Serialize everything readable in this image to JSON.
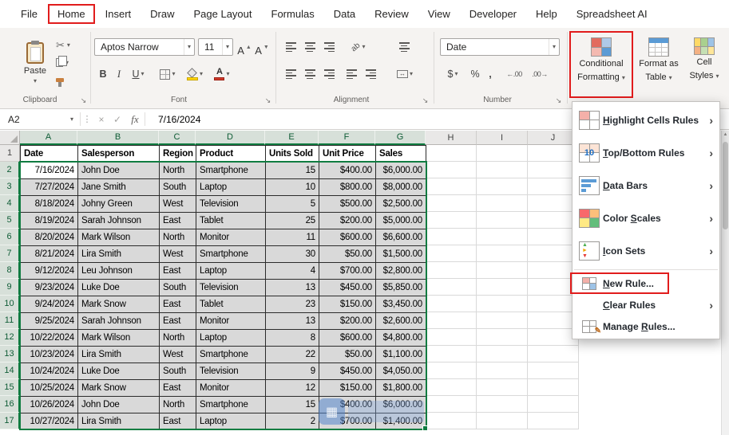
{
  "menu_bar": {
    "items": [
      "File",
      "Home",
      "Insert",
      "Draw",
      "Page Layout",
      "Formulas",
      "Data",
      "Review",
      "View",
      "Developer",
      "Help",
      "Spreadsheet AI"
    ],
    "active_item": "Home"
  },
  "ribbon": {
    "clipboard": {
      "paste": "Paste",
      "group": "Clipboard"
    },
    "font": {
      "name": "Aptos Narrow",
      "size": "11",
      "bold": "B",
      "italic": "I",
      "underline": "U",
      "grow": "A",
      "shrink": "A",
      "color_letter": "A",
      "group": "Font"
    },
    "alignment": {
      "orientation": "ab",
      "group": "Alignment"
    },
    "number": {
      "format": "Date",
      "currency": "$",
      "percent": "%",
      "comma": ",",
      "inc": "←.00",
      "dec": ".00→",
      "group": "Number"
    },
    "styles": {
      "cf1": "Conditional",
      "cf2": "Formatting",
      "fat1": "Format as",
      "fat2": "Table",
      "cs1": "Cell",
      "cs2": "Styles"
    }
  },
  "formula_bar": {
    "name_box": "A2",
    "fx_label": "fx",
    "value": "7/16/2024"
  },
  "sheet": {
    "column_headers": [
      "A",
      "B",
      "C",
      "D",
      "E",
      "F",
      "G",
      "H",
      "I",
      "J"
    ],
    "selected_columns": [
      "A",
      "B",
      "C",
      "D",
      "E",
      "F",
      "G"
    ],
    "row_count": 17,
    "active_cell": "A2",
    "selection": "A2:G17",
    "table": {
      "headers": [
        "Date",
        "Salesperson",
        "Region",
        "Product",
        "Units Sold",
        "Unit Price",
        "Sales"
      ],
      "rows": [
        [
          "7/16/2024",
          "John Doe",
          "North",
          "Smartphone",
          "15",
          "$400.00",
          "$6,000.00"
        ],
        [
          "7/27/2024",
          "Jane Smith",
          "South",
          "Laptop",
          "10",
          "$800.00",
          "$8,000.00"
        ],
        [
          "8/18/2024",
          "Johny Green",
          "West",
          "Television",
          "5",
          "$500.00",
          "$2,500.00"
        ],
        [
          "8/19/2024",
          "Sarah Johnson",
          "East",
          "Tablet",
          "25",
          "$200.00",
          "$5,000.00"
        ],
        [
          "8/20/2024",
          "Mark Wilson",
          "North",
          "Monitor",
          "11",
          "$600.00",
          "$6,600.00"
        ],
        [
          "8/21/2024",
          "Lira Smith",
          "West",
          "Smartphone",
          "30",
          "$50.00",
          "$1,500.00"
        ],
        [
          "9/12/2024",
          "Leu Johnson",
          "East",
          "Laptop",
          "4",
          "$700.00",
          "$2,800.00"
        ],
        [
          "9/23/2024",
          "Luke Doe",
          "South",
          "Television",
          "13",
          "$450.00",
          "$5,850.00"
        ],
        [
          "9/24/2024",
          "Mark Snow",
          "East",
          "Tablet",
          "23",
          "$150.00",
          "$3,450.00"
        ],
        [
          "9/25/2024",
          "Sarah Johnson",
          "East",
          "Monitor",
          "13",
          "$200.00",
          "$2,600.00"
        ],
        [
          "10/22/2024",
          "Mark Wilson",
          "North",
          "Laptop",
          "8",
          "$600.00",
          "$4,800.00"
        ],
        [
          "10/23/2024",
          "Lira Smith",
          "West",
          "Smartphone",
          "22",
          "$50.00",
          "$1,100.00"
        ],
        [
          "10/24/2024",
          "Luke Doe",
          "South",
          "Television",
          "9",
          "$450.00",
          "$4,050.00"
        ],
        [
          "10/25/2024",
          "Mark Snow",
          "East",
          "Monitor",
          "12",
          "$150.00",
          "$1,800.00"
        ],
        [
          "10/26/2024",
          "John Doe",
          "North",
          "Smartphone",
          "15",
          "$400.00",
          "$6,000.00"
        ],
        [
          "10/27/2024",
          "Lira Smith",
          "East",
          "Laptop",
          "2",
          "$700.00",
          "$1,400.00"
        ]
      ]
    }
  },
  "cf_menu": {
    "top_bottom_icon_text": "10",
    "items": [
      {
        "id": "highlight-cells-rules",
        "prefix": "",
        "key": "H",
        "suffix": "ighlight Cells Rules",
        "submenu": true
      },
      {
        "id": "top-bottom-rules",
        "prefix": "",
        "key": "T",
        "suffix": "op/Bottom Rules",
        "submenu": true
      },
      {
        "id": "data-bars",
        "prefix": "",
        "key": "D",
        "suffix": "ata Bars",
        "submenu": true
      },
      {
        "id": "color-scales",
        "prefix": "Color ",
        "key": "S",
        "suffix": "cales",
        "submenu": true
      },
      {
        "id": "icon-sets",
        "prefix": "",
        "key": "I",
        "suffix": "con Sets",
        "submenu": true
      },
      {
        "id": "new-rule",
        "prefix": "",
        "key": "N",
        "suffix": "ew Rule...",
        "submenu": false,
        "highlighted": true
      },
      {
        "id": "clear-rules",
        "prefix": "",
        "key": "C",
        "suffix": "lear Rules",
        "submenu": true
      },
      {
        "id": "manage-rules",
        "prefix": "Manage ",
        "key": "R",
        "suffix": "ules...",
        "submenu": false
      }
    ]
  },
  "colors": {
    "accent_green": "#107C41",
    "highlight_red": "#E11C1C",
    "selection_fill": "#D9D9D9"
  }
}
